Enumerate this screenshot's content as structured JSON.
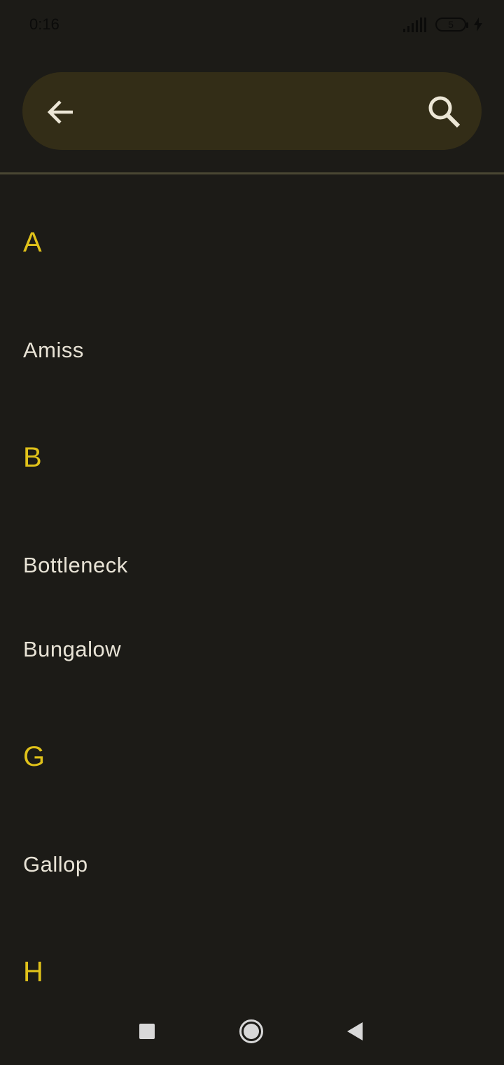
{
  "status_bar": {
    "time": "0:16",
    "battery_level": "5"
  },
  "search": {
    "value": "",
    "placeholder": ""
  },
  "sections": [
    {
      "letter": "A",
      "items": [
        "Amiss"
      ]
    },
    {
      "letter": "B",
      "items": [
        "Bottleneck",
        "Bungalow"
      ]
    },
    {
      "letter": "G",
      "items": [
        "Gallop"
      ]
    },
    {
      "letter": "H",
      "items": []
    }
  ],
  "icons": {
    "back": "arrow-back-icon",
    "search": "search-icon",
    "nav_recent": "square-icon",
    "nav_home": "circle-icon",
    "nav_back": "triangle-back-icon"
  },
  "colors": {
    "background": "#1c1b17",
    "search_bar": "#332d17",
    "section_header": "#e0c21a",
    "item_text": "#e8e3d6"
  }
}
